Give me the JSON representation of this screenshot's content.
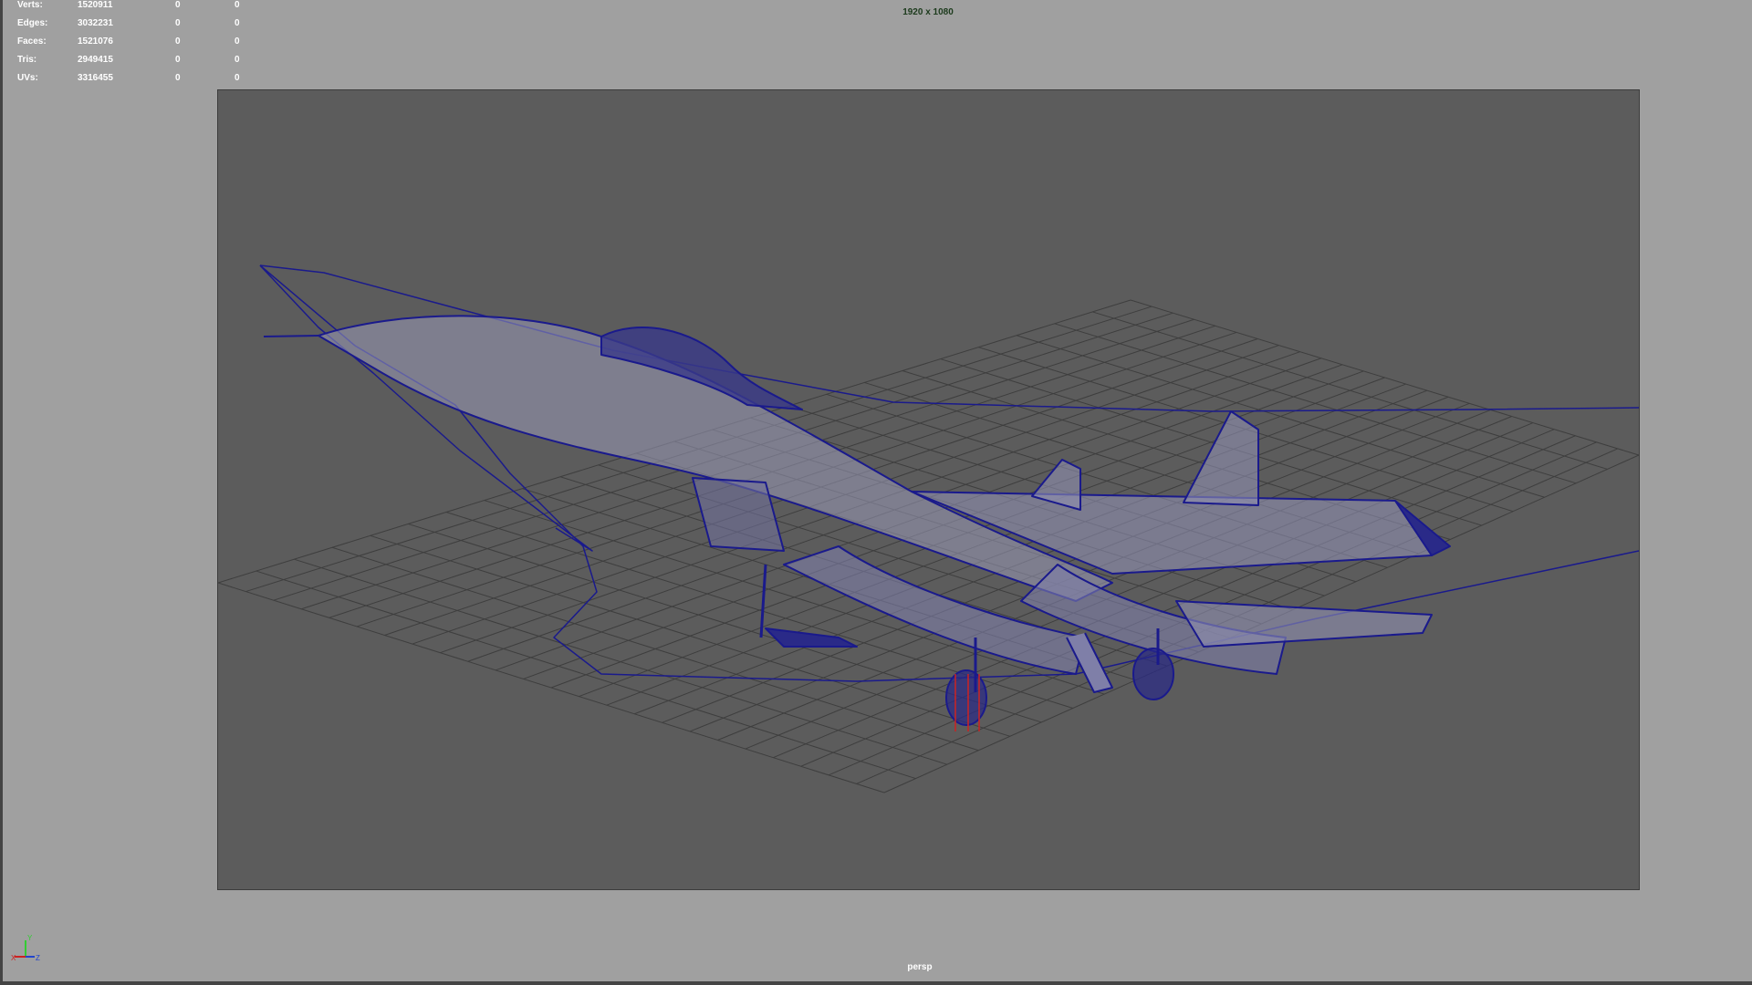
{
  "hud": {
    "rows": [
      {
        "label": "Verts:",
        "total": "1520911",
        "selected": "0",
        "selected2": "0"
      },
      {
        "label": "Edges:",
        "total": "3032231",
        "selected": "0",
        "selected2": "0"
      },
      {
        "label": "Faces:",
        "total": "1521076",
        "selected": "0",
        "selected2": "0"
      },
      {
        "label": "Tris:",
        "total": "2949415",
        "selected": "0",
        "selected2": "0"
      },
      {
        "label": "UVs:",
        "total": "3316455",
        "selected": "0",
        "selected2": "0"
      }
    ]
  },
  "resolution_label": "1920 x 1080",
  "camera_label": "persp",
  "axis_labels": {
    "x": "X",
    "y": "Y",
    "z": "Z"
  },
  "colors": {
    "background": "#a0a0a0",
    "gate": "#5c5c5c",
    "wireframe": "#1a1a8c",
    "grid": "#3a3a3a",
    "pivot": "#cc2222"
  },
  "icons": {
    "axis_gizmo": "view-axis-icon"
  }
}
